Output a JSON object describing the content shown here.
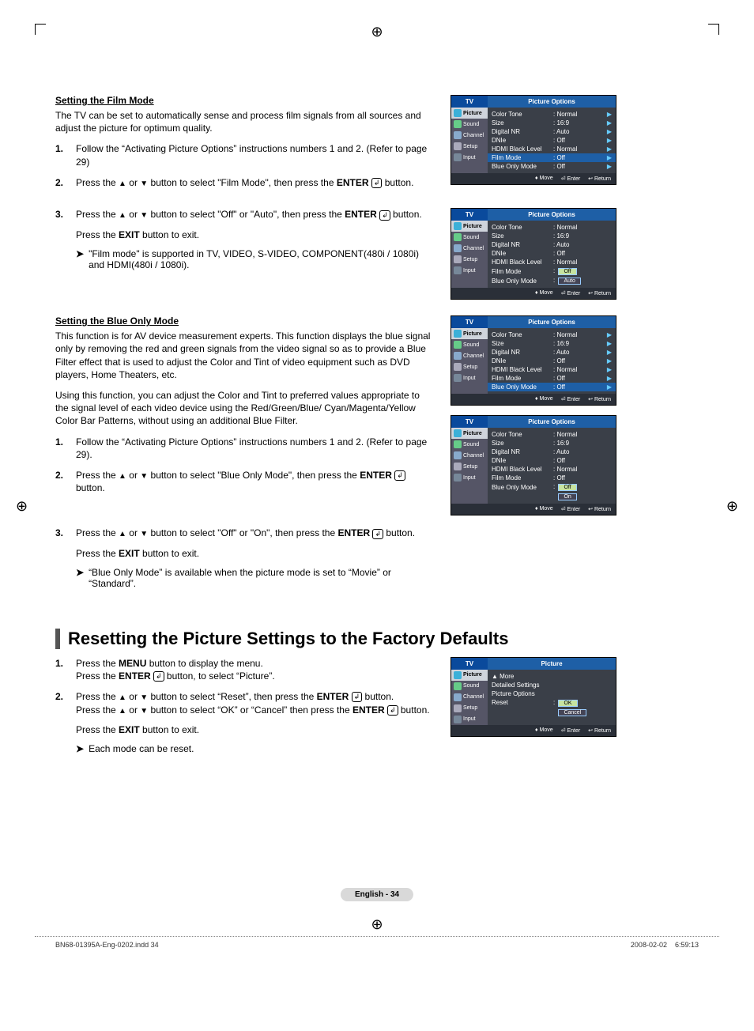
{
  "page": {
    "number_label": "English - 34",
    "footer_left": "BN68-01395A-Eng-0202.indd   34",
    "footer_right": "2008-02-02      6:59:13"
  },
  "glyphs": {
    "enter": "↲",
    "up": "▲",
    "down": "▼",
    "note": "➤",
    "play": "▶"
  },
  "sec1": {
    "title": "Setting the Film Mode",
    "intro": "The TV can be set to automatically sense and process film signals from all sources and adjust the picture for optimum quality.",
    "step1": "Follow the “Activating Picture Options” instructions numbers 1 and 2. (Refer to page 29)",
    "step2_a": "Press the ",
    "step2_b": " or ",
    "step2_c": " button to select \"Film Mode\", then press the ",
    "step2_d": "ENTER ",
    "step2_e": " button.",
    "step3_a": "Press the ",
    "step3_b": " or ",
    "step3_c": " button to select \"Off\" or \"Auto\", then press the ",
    "step3_d": "ENTER ",
    "step3_e": " button.",
    "exit_a": "Press the ",
    "exit_b": "EXIT",
    "exit_c": " button to exit.",
    "note": "\"Film mode\" is supported in TV, VIDEO, S-VIDEO, COMPONENT(480i / 1080i) and HDMI(480i / 1080i)."
  },
  "sec2": {
    "title": "Setting the Blue Only Mode",
    "p1": "This function is for AV device measurement experts. This function displays the blue signal only by removing the red and green signals from the video signal so as to provide a Blue Filter effect that is used to adjust the Color and Tint of video equipment such as DVD players, Home Theaters, etc.",
    "p2": "Using this function, you can adjust the Color and Tint to preferred values appropriate to the signal level of each video device using the Red/Green/Blue/ Cyan/Magenta/Yellow Color Bar Patterns, without using an additional Blue Filter.",
    "step1": "Follow the “Activating Picture Options” instructions numbers 1 and 2. (Refer to page 29).",
    "step2_a": "Press the ",
    "step2_b": " or ",
    "step2_c": " button to select \"Blue Only Mode\", then press the ",
    "step2_d": "ENTER ",
    "step2_e": " button.",
    "step3_a": "Press the ",
    "step3_b": " or ",
    "step3_c": " button to select \"Off\" or \"On\", then press the ",
    "step3_d": "ENTER ",
    "step3_e": " button.",
    "exit_a": "Press the ",
    "exit_b": "EXIT",
    "exit_c": " button to exit.",
    "note": "“Blue Only Mode” is available when the picture mode is set to “Movie” or “Standard”."
  },
  "sec3": {
    "heading": "Resetting the Picture Settings to the Factory Defaults",
    "s1_a": "Press the ",
    "s1_b": "MENU",
    "s1_c": " button to display the menu.",
    "s1_d": "Press the ",
    "s1_e": "ENTER ",
    "s1_f": " button, to select “Picture”.",
    "s2_a": "Press the ",
    "s2_b": " or ",
    "s2_c": " button to select “Reset”, then press the ",
    "s2_d": "ENTER ",
    "s2_e": " button.",
    "s2_f": "Press the ",
    "s2_g": " or ",
    "s2_h": " button to select “OK” or “Cancel” then press the ",
    "s2_i": "ENTER ",
    "s2_j": " button.",
    "exit_a": "Press the ",
    "exit_b": "EXIT",
    "exit_c": " button to exit.",
    "note": "Each mode can be reset."
  },
  "osd": {
    "tv": "TV",
    "title_po": "Picture Options",
    "title_pic": "Picture",
    "side": [
      "Picture",
      "Sound",
      "Channel",
      "Setup",
      "Input"
    ],
    "foot_move": "Move",
    "foot_enter": "Enter",
    "foot_return": "Return",
    "k": {
      "color_tone": "Color Tone",
      "size": "Size",
      "digital_nr": "Digital NR",
      "dnie": "DNIe",
      "hdmi": "HDMI Black Level",
      "film": "Film Mode",
      "blue": "Blue Only Mode",
      "more": "▲ More",
      "detailed": "Detailed Settings",
      "pic_opt": "Picture Options",
      "reset": "Reset"
    },
    "v": {
      "normal": ": Normal",
      "r169": ": 16:9",
      "auto": ": Auto",
      "off": ": Off",
      "opt_off": "Off",
      "opt_auto": "Auto",
      "opt_on": "On",
      "opt_ok": "OK",
      "opt_cancel": "Cancel",
      "colon": ": "
    }
  }
}
